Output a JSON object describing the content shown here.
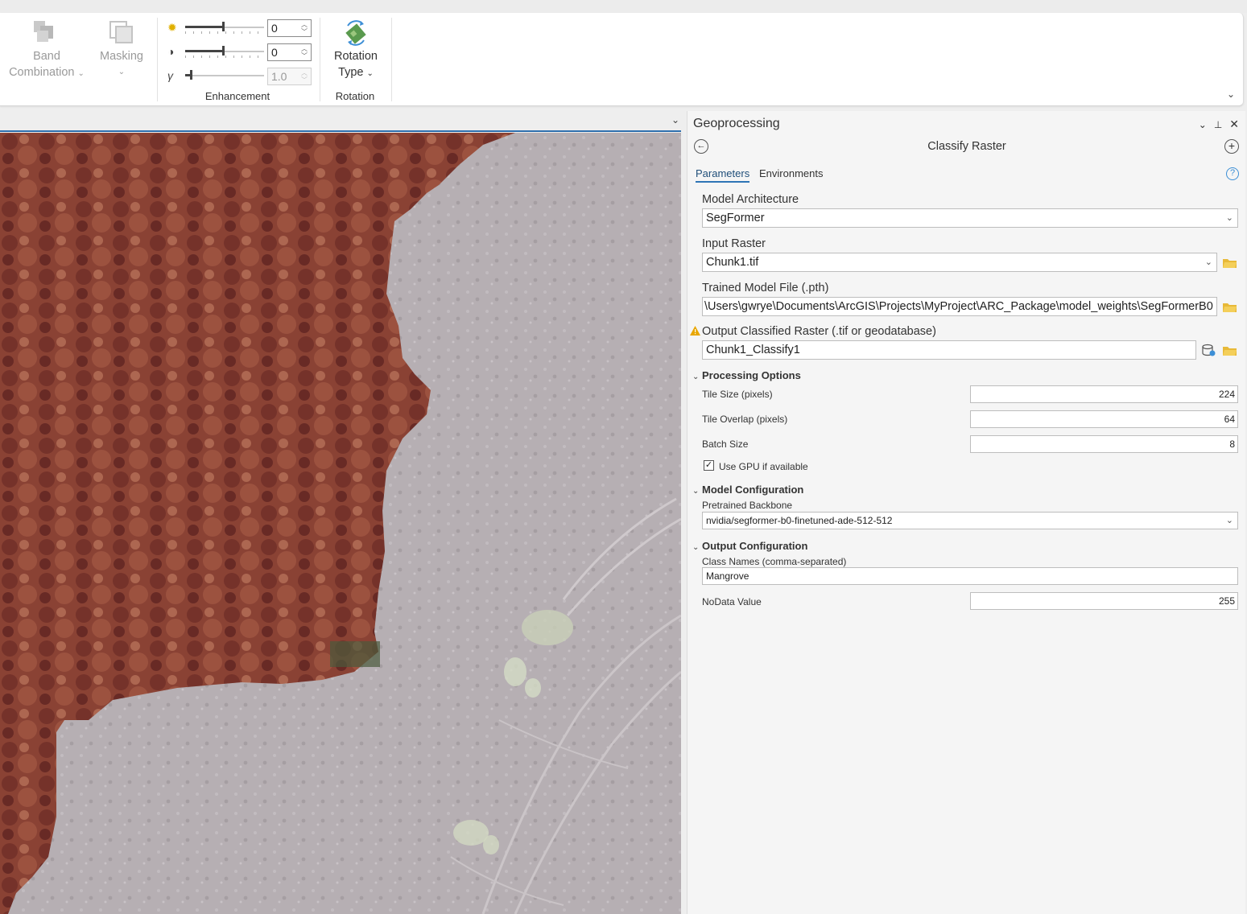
{
  "ribbon": {
    "band_combination": {
      "line1": "Band",
      "line2": "Combination"
    },
    "masking": {
      "label": "Masking"
    },
    "enhancement": {
      "group_label": "Enhancement",
      "brightness": {
        "value": "0"
      },
      "contrast": {
        "value": "0"
      },
      "gamma": {
        "symbol": "γ",
        "value": "1.0"
      }
    },
    "rotation": {
      "line1": "Rotation",
      "line2": "Type",
      "group_label": "Rotation"
    }
  },
  "geoprocessing": {
    "pane_title": "Geoprocessing",
    "tool_title": "Classify Raster",
    "tabs": [
      "Parameters",
      "Environments"
    ],
    "params": {
      "model_architecture": {
        "label": "Model Architecture",
        "value": "SegFormer"
      },
      "input_raster": {
        "label": "Input Raster",
        "value": "Chunk1.tif"
      },
      "trained_model": {
        "label": "Trained Model File (.pth)",
        "value": "\\Users\\gwrye\\Documents\\ArcGIS\\Projects\\MyProject\\ARC_Package\\model_weights\\SegFormerB0"
      },
      "output_raster": {
        "label": "Output Classified Raster (.tif or geodatabase)",
        "value": "Chunk1_Classify1"
      }
    },
    "processing_options": {
      "title": "Processing Options",
      "tile_size": {
        "label": "Tile Size (pixels)",
        "value": "224"
      },
      "tile_overlap": {
        "label": "Tile Overlap (pixels)",
        "value": "64"
      },
      "batch_size": {
        "label": "Batch Size",
        "value": "8"
      },
      "use_gpu": {
        "label": "Use GPU if available",
        "checked": true
      }
    },
    "model_configuration": {
      "title": "Model Configuration",
      "backbone": {
        "label": "Pretrained Backbone",
        "value": "nvidia/segformer-b0-finetuned-ade-512-512"
      }
    },
    "output_configuration": {
      "title": "Output Configuration",
      "class_names": {
        "label": "Class Names (comma-separated)",
        "value": "Mangrove"
      },
      "nodata": {
        "label": "NoData Value",
        "value": "255"
      }
    }
  },
  "colors": {
    "accent": "#2e75b6",
    "mangrove_overlay": "#8b3a2f",
    "ground": "#b4adb1"
  }
}
